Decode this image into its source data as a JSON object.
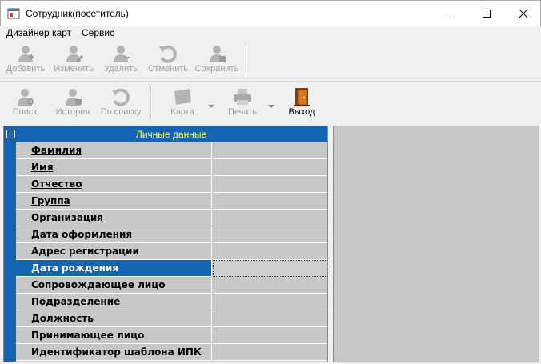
{
  "window": {
    "title": "Сотрудник(посетитель)"
  },
  "menu": [
    {
      "label": "Дизайнер карт"
    },
    {
      "label": "Сервис"
    }
  ],
  "toolbar1": [
    {
      "label": "Добавить",
      "icon": "person-add-icon",
      "enabled": false
    },
    {
      "label": "Изменить",
      "icon": "person-edit-icon",
      "enabled": false
    },
    {
      "label": "Удалить",
      "icon": "person-delete-icon",
      "enabled": false
    },
    {
      "label": "Отменить",
      "icon": "undo-icon",
      "enabled": false
    },
    {
      "label": "Сохранить",
      "icon": "person-save-icon",
      "enabled": false
    }
  ],
  "toolbar2": [
    {
      "label": "Поиск",
      "icon": "person-search-icon",
      "enabled": false
    },
    {
      "label": "История",
      "icon": "person-history-icon",
      "enabled": false
    },
    {
      "label": "По списку",
      "icon": "list-refresh-icon",
      "enabled": false
    },
    {
      "label": "Карта",
      "icon": "card-icon",
      "enabled": false
    },
    {
      "label": "Печать",
      "icon": "printer-icon",
      "enabled": false
    },
    {
      "label": "Выход",
      "icon": "exit-door-icon",
      "enabled": true
    }
  ],
  "grid": {
    "header": "Личные данные",
    "rows": [
      {
        "label": "Фамилия",
        "value": "",
        "underline": true
      },
      {
        "label": "Имя",
        "value": "",
        "underline": true
      },
      {
        "label": "Отчество",
        "value": "",
        "underline": true
      },
      {
        "label": "Группа",
        "value": "",
        "underline": true
      },
      {
        "label": "Организация",
        "value": "",
        "underline": true
      },
      {
        "label": "Дата оформления",
        "value": "",
        "underline": false
      },
      {
        "label": "Адрес регистрации",
        "value": "",
        "underline": false
      },
      {
        "label": "Дата рождения",
        "value": "",
        "underline": false,
        "selected": true
      },
      {
        "label": "Сопровождающее лицо",
        "value": "",
        "underline": false
      },
      {
        "label": "Подразделение",
        "value": "",
        "underline": false
      },
      {
        "label": "Должность",
        "value": "",
        "underline": false
      },
      {
        "label": "Принимающее лицо",
        "value": "",
        "underline": false
      },
      {
        "label": "Идентификатор шаблона ИПК",
        "value": "",
        "underline": false
      }
    ]
  },
  "colors": {
    "grid_header": "#1464b4",
    "header_text": "#ffff5a",
    "cell_bg": "#c8c8c8"
  }
}
